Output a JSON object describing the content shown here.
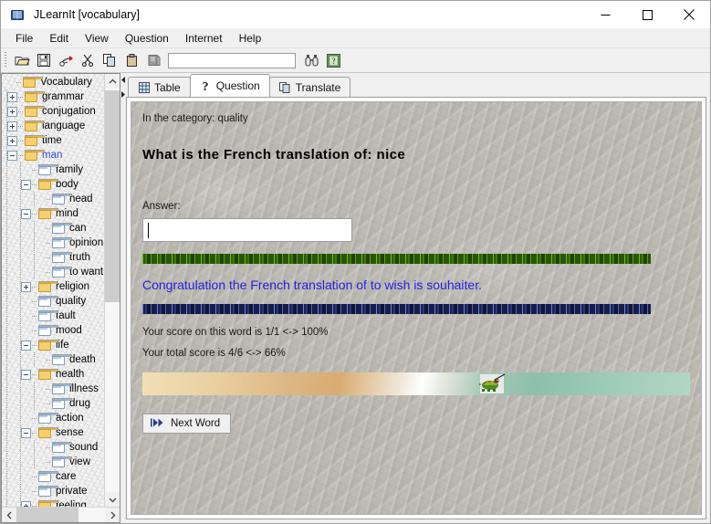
{
  "window": {
    "title": "JLearnIt [vocabulary]",
    "icon": "book-icon",
    "minimize": "minimize",
    "maximize": "maximize",
    "close": "close"
  },
  "menubar": {
    "items": [
      {
        "label": "File"
      },
      {
        "label": "Edit"
      },
      {
        "label": "View"
      },
      {
        "label": "Question"
      },
      {
        "label": "Internet"
      },
      {
        "label": "Help"
      }
    ]
  },
  "toolbar": {
    "buttons": [
      {
        "name": "open-icon",
        "title": "Open"
      },
      {
        "name": "save-icon",
        "title": "Save"
      },
      {
        "name": "paint-icon",
        "title": "Paint"
      },
      {
        "name": "cut-icon",
        "title": "Cut"
      },
      {
        "name": "copy-icon",
        "title": "Copy"
      },
      {
        "name": "paste-icon",
        "title": "Paste"
      },
      {
        "name": "edit-icon",
        "title": "Edit"
      }
    ],
    "search": {
      "value": "",
      "placeholder": ""
    },
    "right_buttons": [
      {
        "name": "binoculars-icon",
        "title": "Find"
      },
      {
        "name": "help-icon",
        "title": "Help"
      }
    ]
  },
  "tree": {
    "root": "Vocabulary",
    "selected": "man",
    "items": [
      {
        "label": "Vocabulary",
        "depth": 0,
        "toggle": "none",
        "folder": "closed"
      },
      {
        "label": "grammar",
        "depth": 1,
        "toggle": "plus",
        "folder": "closed"
      },
      {
        "label": "conjugation",
        "depth": 1,
        "toggle": "plus",
        "folder": "closed"
      },
      {
        "label": "language",
        "depth": 1,
        "toggle": "plus",
        "folder": "closed"
      },
      {
        "label": "time",
        "depth": 1,
        "toggle": "plus",
        "folder": "closed"
      },
      {
        "label": "man",
        "depth": 1,
        "toggle": "minus",
        "folder": "closed",
        "selected": true
      },
      {
        "label": "family",
        "depth": 2,
        "toggle": "none",
        "folder": "leaf"
      },
      {
        "label": "body",
        "depth": 2,
        "toggle": "minus",
        "folder": "closed"
      },
      {
        "label": "head",
        "depth": 3,
        "toggle": "none",
        "folder": "leaf"
      },
      {
        "label": "mind",
        "depth": 2,
        "toggle": "minus",
        "folder": "closed"
      },
      {
        "label": "can",
        "depth": 3,
        "toggle": "none",
        "folder": "leaf"
      },
      {
        "label": "opinion",
        "depth": 3,
        "toggle": "none",
        "folder": "leaf"
      },
      {
        "label": "truth",
        "depth": 3,
        "toggle": "none",
        "folder": "leaf"
      },
      {
        "label": "to want",
        "depth": 3,
        "toggle": "none",
        "folder": "leaf"
      },
      {
        "label": "religion",
        "depth": 2,
        "toggle": "plus",
        "folder": "closed"
      },
      {
        "label": "quality",
        "depth": 2,
        "toggle": "none",
        "folder": "leaf"
      },
      {
        "label": "fault",
        "depth": 2,
        "toggle": "none",
        "folder": "leaf"
      },
      {
        "label": "mood",
        "depth": 2,
        "toggle": "none",
        "folder": "leaf"
      },
      {
        "label": "life",
        "depth": 2,
        "toggle": "minus",
        "folder": "closed"
      },
      {
        "label": "death",
        "depth": 3,
        "toggle": "none",
        "folder": "leaf"
      },
      {
        "label": "health",
        "depth": 2,
        "toggle": "minus",
        "folder": "closed"
      },
      {
        "label": "illness",
        "depth": 3,
        "toggle": "none",
        "folder": "leaf"
      },
      {
        "label": "drug",
        "depth": 3,
        "toggle": "none",
        "folder": "leaf"
      },
      {
        "label": "action",
        "depth": 2,
        "toggle": "none",
        "folder": "leaf"
      },
      {
        "label": "sense",
        "depth": 2,
        "toggle": "minus",
        "folder": "closed"
      },
      {
        "label": "sound",
        "depth": 3,
        "toggle": "none",
        "folder": "leaf"
      },
      {
        "label": "view",
        "depth": 3,
        "toggle": "none",
        "folder": "leaf"
      },
      {
        "label": "care",
        "depth": 2,
        "toggle": "none",
        "folder": "leaf"
      },
      {
        "label": "private",
        "depth": 2,
        "toggle": "none",
        "folder": "leaf"
      },
      {
        "label": "feeling",
        "depth": 2,
        "toggle": "plus",
        "folder": "closed"
      }
    ]
  },
  "tabs": [
    {
      "label": "Table",
      "icon": "table-icon",
      "active": false
    },
    {
      "label": "Question",
      "icon": "question-icon",
      "active": true
    },
    {
      "label": "Translate",
      "icon": "translate-icon",
      "active": false
    }
  ],
  "question_pane": {
    "category_line": "In the category: quality",
    "question": "What is the French translation of: nice",
    "answer_label": "Answer:",
    "answer_value": "",
    "answer_placeholder": "",
    "feedback": "Congratulation the French translation of to wish is souhaiter.",
    "score_word": "Your score on this word is 1/1 <-> 100%",
    "score_total": "Your total score is 4/6 <-> 66%",
    "next_button": "Next Word",
    "decorations": {
      "grass_bar": "grass-texture-bar",
      "water_bar": "water-texture-bar",
      "beach_image": "beach-scene-with-turtle"
    }
  },
  "colors": {
    "feedback_blue": "#2222dd",
    "selected_node": "#2b4fdc",
    "folder_yellow": "#f5d070",
    "grass_green": "#2e5c06",
    "water_blue": "#141b42"
  }
}
